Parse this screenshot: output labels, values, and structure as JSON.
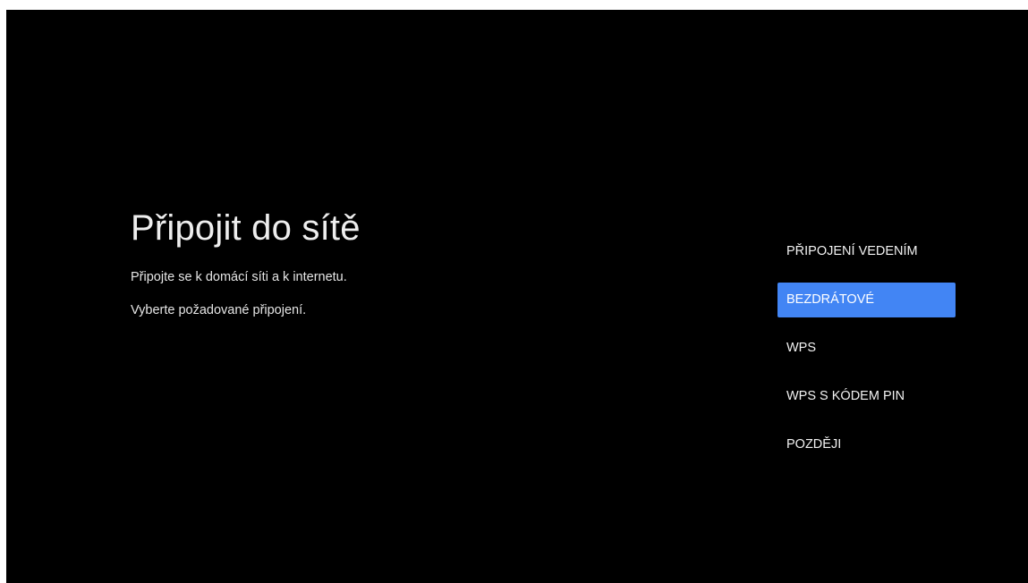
{
  "setup": {
    "title": "Připojit do sítě",
    "description_line1": "Připojte se k domácí síti a k internetu.",
    "description_line2": "Vyberte požadované připojení."
  },
  "menu": {
    "selected_index": 1,
    "items": [
      {
        "label": "PŘIPOJENÍ VEDENÍM"
      },
      {
        "label": "BEZDRÁTOVÉ"
      },
      {
        "label": "WPS"
      },
      {
        "label": "WPS S KÓDEM PIN"
      },
      {
        "label": "POZDĚJI"
      }
    ],
    "accent_color": "#4285f4"
  },
  "colors": {
    "background": "#000000",
    "text": "#eeeeee"
  }
}
